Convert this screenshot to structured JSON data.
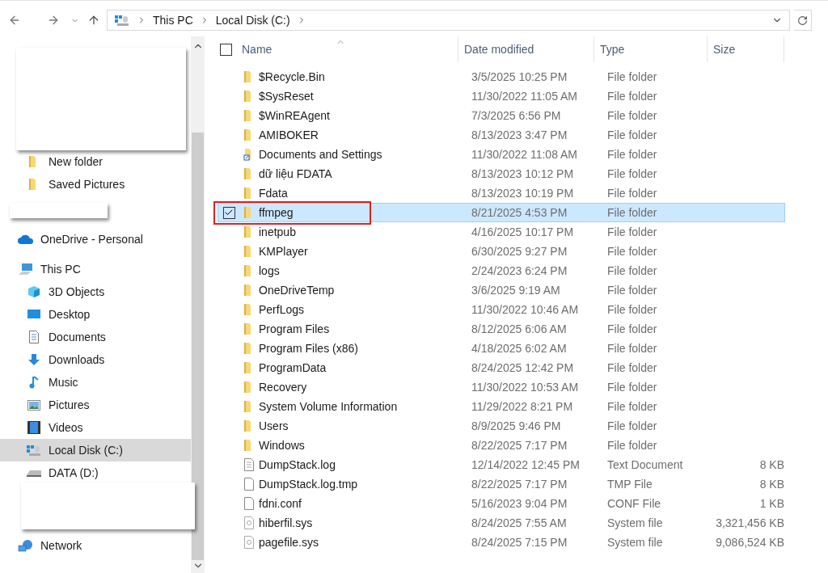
{
  "address_bar": {
    "segments": [
      "This PC",
      "Local Disk (C:)"
    ]
  },
  "sidebar": {
    "items": [
      {
        "label": "New folder",
        "kind": "folder",
        "selected": false
      },
      {
        "label": "Saved Pictures",
        "kind": "folder",
        "selected": false
      },
      {
        "label": "OneDrive - Personal",
        "kind": "cloud",
        "selected": false
      },
      {
        "label": "This PC",
        "kind": "pc",
        "selected": false,
        "children": [
          {
            "label": "3D Objects",
            "kind": "cube",
            "selected": false
          },
          {
            "label": "Desktop",
            "kind": "desktop",
            "selected": false
          },
          {
            "label": "Documents",
            "kind": "documents",
            "selected": false
          },
          {
            "label": "Downloads",
            "kind": "downloads",
            "selected": false
          },
          {
            "label": "Music",
            "kind": "music",
            "selected": false
          },
          {
            "label": "Pictures",
            "kind": "pictures",
            "selected": false
          },
          {
            "label": "Videos",
            "kind": "videos",
            "selected": false
          },
          {
            "label": "Local Disk (C:)",
            "kind": "system_drive",
            "selected": true
          },
          {
            "label": "DATA (D:)",
            "kind": "drive",
            "selected": false
          }
        ]
      },
      {
        "label": "Network",
        "kind": "network",
        "selected": false
      }
    ]
  },
  "table": {
    "select_all": {
      "checked": false
    },
    "columns": [
      "Name",
      "Date modified",
      "Type",
      "Size"
    ],
    "rows": [
      {
        "name": "$Recycle.Bin",
        "date": "3/5/2025 10:25 PM",
        "type": "File folder",
        "kind": "folder",
        "selected": false
      },
      {
        "name": "$SysReset",
        "date": "11/30/2022 11:05 AM",
        "type": "File folder",
        "kind": "folder",
        "selected": false
      },
      {
        "name": "$WinREAgent",
        "date": "7/3/2025 6:56 PM",
        "type": "File folder",
        "kind": "folder",
        "selected": false
      },
      {
        "name": "AMIBOKER",
        "date": "8/13/2023 3:47 PM",
        "type": "File folder",
        "kind": "folder",
        "selected": false
      },
      {
        "name": "Documents and Settings",
        "date": "11/30/2022 11:08 AM",
        "type": "File folder",
        "kind": "link",
        "selected": false
      },
      {
        "name": "dữ liệu FDATA",
        "date": "8/13/2023 10:12 PM",
        "type": "File folder",
        "kind": "folder",
        "selected": false
      },
      {
        "name": "Fdata",
        "date": "8/13/2023 10:19 PM",
        "type": "File folder",
        "kind": "folder",
        "selected": false
      },
      {
        "name": "ffmpeg",
        "date": "8/21/2025 4:53 PM",
        "type": "File folder",
        "kind": "folder",
        "selected": true,
        "highlighted": true
      },
      {
        "name": "inetpub",
        "date": "4/16/2025 10:17 PM",
        "type": "File folder",
        "kind": "folder",
        "selected": false
      },
      {
        "name": "KMPlayer",
        "date": "6/30/2025 9:27 PM",
        "type": "File folder",
        "kind": "folder",
        "selected": false
      },
      {
        "name": "logs",
        "date": "2/24/2023 6:24 PM",
        "type": "File folder",
        "kind": "folder",
        "selected": false
      },
      {
        "name": "OneDriveTemp",
        "date": "3/6/2025 9:19 AM",
        "type": "File folder",
        "kind": "folder",
        "selected": false
      },
      {
        "name": "PerfLogs",
        "date": "11/30/2022 10:46 AM",
        "type": "File folder",
        "kind": "folder",
        "selected": false
      },
      {
        "name": "Program Files",
        "date": "8/12/2025 6:06 AM",
        "type": "File folder",
        "kind": "folder",
        "selected": false
      },
      {
        "name": "Program Files (x86)",
        "date": "4/18/2025 6:02 AM",
        "type": "File folder",
        "kind": "folder",
        "selected": false
      },
      {
        "name": "ProgramData",
        "date": "8/24/2025 12:42 PM",
        "type": "File folder",
        "kind": "folder",
        "selected": false
      },
      {
        "name": "Recovery",
        "date": "11/30/2022 10:53 AM",
        "type": "File folder",
        "kind": "folder",
        "selected": false
      },
      {
        "name": "System Volume Information",
        "date": "11/29/2022 8:21 PM",
        "type": "File folder",
        "kind": "folder",
        "selected": false
      },
      {
        "name": "Users",
        "date": "8/9/2025 9:46 PM",
        "type": "File folder",
        "kind": "folder",
        "selected": false
      },
      {
        "name": "Windows",
        "date": "8/22/2025 7:17 PM",
        "type": "File folder",
        "kind": "folder",
        "selected": false
      },
      {
        "name": "DumpStack.log",
        "date": "12/14/2022 12:45 PM",
        "type": "Text Document",
        "size": "8 KB",
        "kind": "text",
        "selected": false
      },
      {
        "name": "DumpStack.log.tmp",
        "date": "8/22/2025 7:17 PM",
        "type": "TMP File",
        "size": "8 KB",
        "kind": "file",
        "selected": false
      },
      {
        "name": "fdni.conf",
        "date": "5/16/2023 9:04 PM",
        "type": "CONF File",
        "size": "1 KB",
        "kind": "file",
        "selected": false
      },
      {
        "name": "hiberfil.sys",
        "date": "8/24/2025 7:55 AM",
        "type": "System file",
        "size": "3,321,456 KB",
        "kind": "system",
        "selected": false
      },
      {
        "name": "pagefile.sys",
        "date": "8/24/2025 7:15 PM",
        "type": "System file",
        "size": "9,086,524 KB",
        "kind": "system",
        "selected": false
      }
    ]
  }
}
